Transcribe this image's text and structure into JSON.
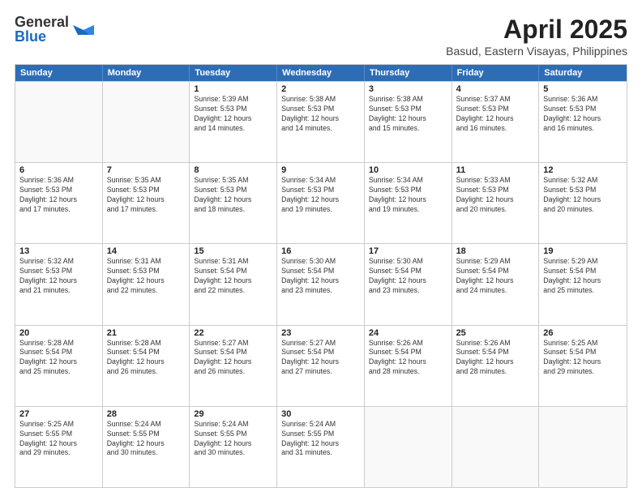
{
  "logo": {
    "general": "General",
    "blue": "Blue"
  },
  "title": "April 2025",
  "subtitle": "Basud, Eastern Visayas, Philippines",
  "header_days": [
    "Sunday",
    "Monday",
    "Tuesday",
    "Wednesday",
    "Thursday",
    "Friday",
    "Saturday"
  ],
  "rows": [
    [
      {
        "day": "",
        "empty": true
      },
      {
        "day": "",
        "empty": true
      },
      {
        "day": "1",
        "lines": [
          "Sunrise: 5:39 AM",
          "Sunset: 5:53 PM",
          "Daylight: 12 hours",
          "and 14 minutes."
        ]
      },
      {
        "day": "2",
        "lines": [
          "Sunrise: 5:38 AM",
          "Sunset: 5:53 PM",
          "Daylight: 12 hours",
          "and 14 minutes."
        ]
      },
      {
        "day": "3",
        "lines": [
          "Sunrise: 5:38 AM",
          "Sunset: 5:53 PM",
          "Daylight: 12 hours",
          "and 15 minutes."
        ]
      },
      {
        "day": "4",
        "lines": [
          "Sunrise: 5:37 AM",
          "Sunset: 5:53 PM",
          "Daylight: 12 hours",
          "and 16 minutes."
        ]
      },
      {
        "day": "5",
        "lines": [
          "Sunrise: 5:36 AM",
          "Sunset: 5:53 PM",
          "Daylight: 12 hours",
          "and 16 minutes."
        ]
      }
    ],
    [
      {
        "day": "6",
        "lines": [
          "Sunrise: 5:36 AM",
          "Sunset: 5:53 PM",
          "Daylight: 12 hours",
          "and 17 minutes."
        ]
      },
      {
        "day": "7",
        "lines": [
          "Sunrise: 5:35 AM",
          "Sunset: 5:53 PM",
          "Daylight: 12 hours",
          "and 17 minutes."
        ]
      },
      {
        "day": "8",
        "lines": [
          "Sunrise: 5:35 AM",
          "Sunset: 5:53 PM",
          "Daylight: 12 hours",
          "and 18 minutes."
        ]
      },
      {
        "day": "9",
        "lines": [
          "Sunrise: 5:34 AM",
          "Sunset: 5:53 PM",
          "Daylight: 12 hours",
          "and 19 minutes."
        ]
      },
      {
        "day": "10",
        "lines": [
          "Sunrise: 5:34 AM",
          "Sunset: 5:53 PM",
          "Daylight: 12 hours",
          "and 19 minutes."
        ]
      },
      {
        "day": "11",
        "lines": [
          "Sunrise: 5:33 AM",
          "Sunset: 5:53 PM",
          "Daylight: 12 hours",
          "and 20 minutes."
        ]
      },
      {
        "day": "12",
        "lines": [
          "Sunrise: 5:32 AM",
          "Sunset: 5:53 PM",
          "Daylight: 12 hours",
          "and 20 minutes."
        ]
      }
    ],
    [
      {
        "day": "13",
        "lines": [
          "Sunrise: 5:32 AM",
          "Sunset: 5:53 PM",
          "Daylight: 12 hours",
          "and 21 minutes."
        ]
      },
      {
        "day": "14",
        "lines": [
          "Sunrise: 5:31 AM",
          "Sunset: 5:53 PM",
          "Daylight: 12 hours",
          "and 22 minutes."
        ]
      },
      {
        "day": "15",
        "lines": [
          "Sunrise: 5:31 AM",
          "Sunset: 5:54 PM",
          "Daylight: 12 hours",
          "and 22 minutes."
        ]
      },
      {
        "day": "16",
        "lines": [
          "Sunrise: 5:30 AM",
          "Sunset: 5:54 PM",
          "Daylight: 12 hours",
          "and 23 minutes."
        ]
      },
      {
        "day": "17",
        "lines": [
          "Sunrise: 5:30 AM",
          "Sunset: 5:54 PM",
          "Daylight: 12 hours",
          "and 23 minutes."
        ]
      },
      {
        "day": "18",
        "lines": [
          "Sunrise: 5:29 AM",
          "Sunset: 5:54 PM",
          "Daylight: 12 hours",
          "and 24 minutes."
        ]
      },
      {
        "day": "19",
        "lines": [
          "Sunrise: 5:29 AM",
          "Sunset: 5:54 PM",
          "Daylight: 12 hours",
          "and 25 minutes."
        ]
      }
    ],
    [
      {
        "day": "20",
        "lines": [
          "Sunrise: 5:28 AM",
          "Sunset: 5:54 PM",
          "Daylight: 12 hours",
          "and 25 minutes."
        ]
      },
      {
        "day": "21",
        "lines": [
          "Sunrise: 5:28 AM",
          "Sunset: 5:54 PM",
          "Daylight: 12 hours",
          "and 26 minutes."
        ]
      },
      {
        "day": "22",
        "lines": [
          "Sunrise: 5:27 AM",
          "Sunset: 5:54 PM",
          "Daylight: 12 hours",
          "and 26 minutes."
        ]
      },
      {
        "day": "23",
        "lines": [
          "Sunrise: 5:27 AM",
          "Sunset: 5:54 PM",
          "Daylight: 12 hours",
          "and 27 minutes."
        ]
      },
      {
        "day": "24",
        "lines": [
          "Sunrise: 5:26 AM",
          "Sunset: 5:54 PM",
          "Daylight: 12 hours",
          "and 28 minutes."
        ]
      },
      {
        "day": "25",
        "lines": [
          "Sunrise: 5:26 AM",
          "Sunset: 5:54 PM",
          "Daylight: 12 hours",
          "and 28 minutes."
        ]
      },
      {
        "day": "26",
        "lines": [
          "Sunrise: 5:25 AM",
          "Sunset: 5:54 PM",
          "Daylight: 12 hours",
          "and 29 minutes."
        ]
      }
    ],
    [
      {
        "day": "27",
        "lines": [
          "Sunrise: 5:25 AM",
          "Sunset: 5:55 PM",
          "Daylight: 12 hours",
          "and 29 minutes."
        ]
      },
      {
        "day": "28",
        "lines": [
          "Sunrise: 5:24 AM",
          "Sunset: 5:55 PM",
          "Daylight: 12 hours",
          "and 30 minutes."
        ]
      },
      {
        "day": "29",
        "lines": [
          "Sunrise: 5:24 AM",
          "Sunset: 5:55 PM",
          "Daylight: 12 hours",
          "and 30 minutes."
        ]
      },
      {
        "day": "30",
        "lines": [
          "Sunrise: 5:24 AM",
          "Sunset: 5:55 PM",
          "Daylight: 12 hours",
          "and 31 minutes."
        ]
      },
      {
        "day": "",
        "empty": true
      },
      {
        "day": "",
        "empty": true
      },
      {
        "day": "",
        "empty": true
      }
    ]
  ]
}
